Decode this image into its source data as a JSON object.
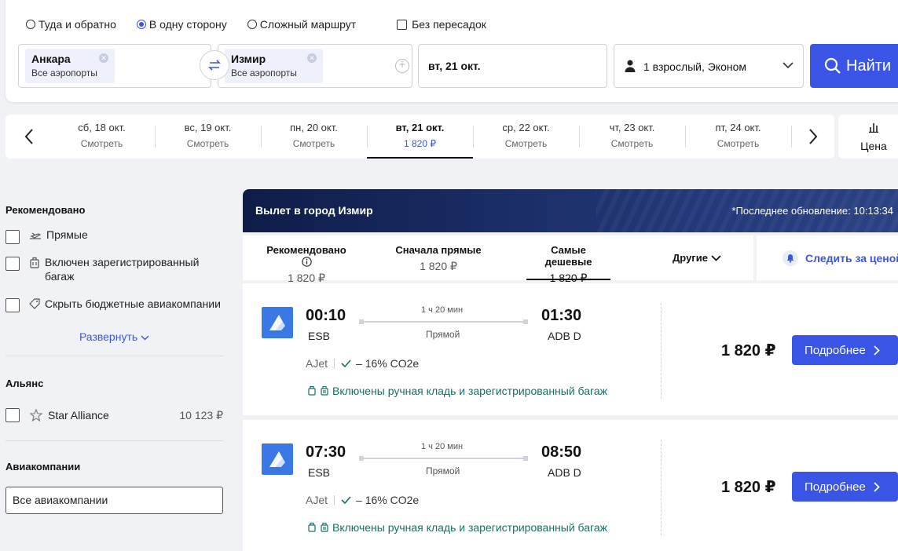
{
  "search": {
    "trip_types": [
      {
        "label": "Туда и обратно",
        "checked": false
      },
      {
        "label": "В одну сторону",
        "checked": true
      },
      {
        "label": "Сложный маршрут",
        "checked": false
      }
    ],
    "nonstop_label": "Без пересадок",
    "from": {
      "city": "Анкара",
      "sub": "Все аэропорты"
    },
    "to": {
      "city": "Измир",
      "sub": "Все аэропорты"
    },
    "date": "вт, 21 окт.",
    "passengers": "1 взрослый, Эконом",
    "button_label": "Найти"
  },
  "date_strip": {
    "days": [
      {
        "date": "сб, 18 окт.",
        "price": "Смотреть"
      },
      {
        "date": "вс, 19 окт.",
        "price": "Смотреть"
      },
      {
        "date": "пн, 20 окт.",
        "price": "Смотреть"
      },
      {
        "date": "вт, 21 окт.",
        "price": "1 820 ₽"
      },
      {
        "date": "ср, 22 окт.",
        "price": "Смотреть"
      },
      {
        "date": "чт, 23 окт.",
        "price": "Смотреть"
      },
      {
        "date": "пт, 24 окт.",
        "price": "Смотреть"
      }
    ],
    "price_tab_label": "Цена"
  },
  "filters": {
    "recommended_title": "Рекомендовано",
    "recommended_items": [
      "Прямые",
      "Включен зарегистрированный багаж",
      "Скрыть бюджетные авиакомпании"
    ],
    "expand_label": "Развернуть",
    "alliance_title": "Альянс",
    "alliance_item": {
      "label": "Star Alliance",
      "price": "10 123 ₽"
    },
    "airlines_title": "Авиакомпании",
    "all_airlines_label": "Все авиакомпании"
  },
  "results": {
    "header_title": "Вылет в город Измир",
    "updated": "*Последнее обновление: 10:13:34",
    "sort_tabs": [
      {
        "name": "Рекомендовано",
        "value": "1 820 ₽"
      },
      {
        "name": "Сначала прямые",
        "value": "1 820 ₽"
      },
      {
        "name": "Самые дешевые",
        "value": "1 820 ₽"
      },
      {
        "name": "Другие",
        "value": ""
      }
    ],
    "watch_label": "Следить за ценой",
    "flights": [
      {
        "dep_time": "00:10",
        "dep_airport": "ESB",
        "arr_time": "01:30",
        "arr_airport": "ADB D",
        "duration": "1 ч 20 мин",
        "stops": "Прямой",
        "airline": "AJet",
        "co2": "– 16% CO2e",
        "baggage": "Включены ручная кладь и зарегистрированный багаж",
        "price": "1 820 ₽",
        "button": "Подробнее"
      },
      {
        "dep_time": "07:30",
        "dep_airport": "ESB",
        "arr_time": "08:50",
        "arr_airport": "ADB D",
        "duration": "1 ч 20 мин",
        "stops": "Прямой",
        "airline": "AJet",
        "co2": "– 16% CO2e",
        "baggage": "Включены ручная кладь и зарегистрированный багаж",
        "price": "1 820 ₽",
        "button": "Подробнее"
      }
    ]
  },
  "colors": {
    "accent": "#3a55e6",
    "baggage_green": "#1b6e66",
    "header_navy": "#0e1c48"
  }
}
